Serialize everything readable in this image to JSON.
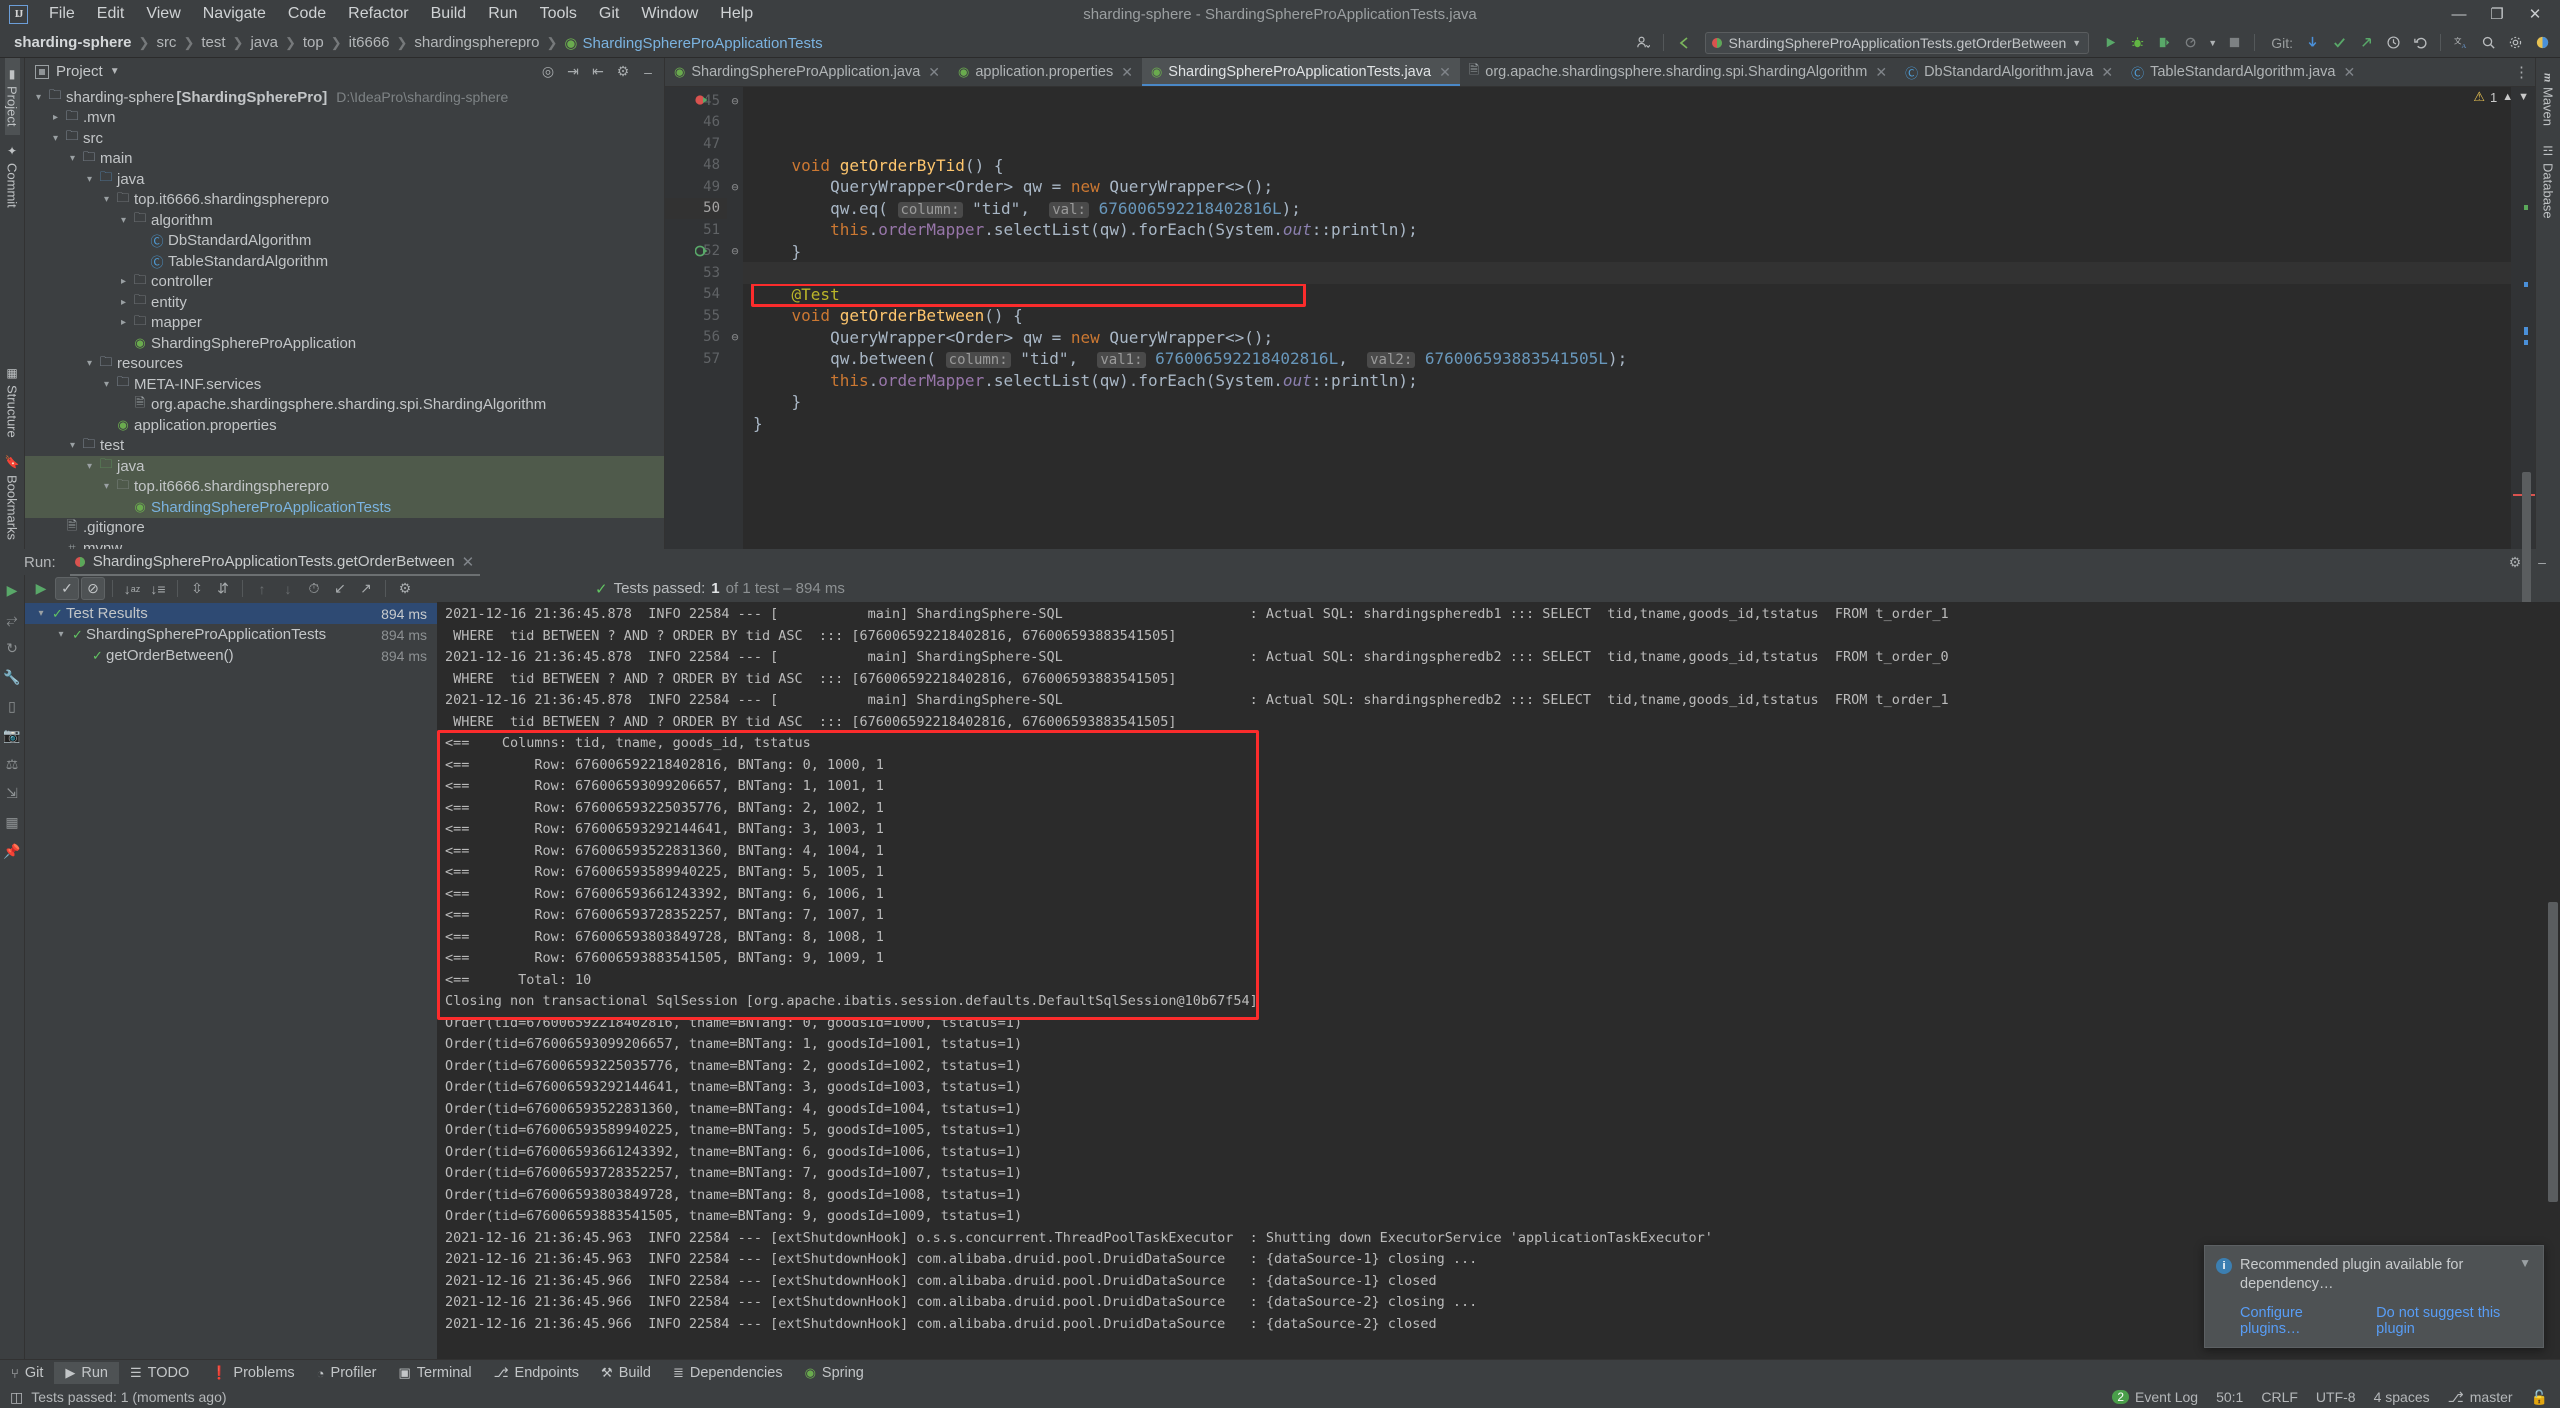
{
  "window": {
    "title": "sharding-sphere - ShardingSphereProApplicationTests.java",
    "logo": "IJ",
    "minimize": "—",
    "maximize": "❐",
    "close": "✕"
  },
  "menu": [
    "File",
    "Edit",
    "View",
    "Navigate",
    "Code",
    "Refactor",
    "Build",
    "Run",
    "Tools",
    "Git",
    "Window",
    "Help"
  ],
  "navbar": {
    "breadcrumbs": [
      "sharding-sphere",
      "src",
      "test",
      "java",
      "top",
      "it6666",
      "shardingspherepro",
      "ShardingSphereProApplicationTests"
    ],
    "run_config": "ShardingSphereProApplicationTests.getOrderBetween",
    "git_label": "Git:",
    "icons": {
      "user": "user-icon",
      "back": "back-arrow-icon",
      "run": "run-icon",
      "debug": "debug-icon",
      "coverage": "coverage-icon",
      "profile": "profile-icon",
      "stop": "stop-icon",
      "update": "git-update-icon",
      "commit": "git-commit-icon",
      "push": "git-push-icon",
      "history": "history-icon",
      "rollback": "rollback-icon",
      "translate": "translate-icon",
      "search": "search-icon",
      "settings": "settings-icon",
      "layout": "layout-icon"
    }
  },
  "left_strip": {
    "tabs": [
      {
        "label": "Project",
        "icon": "project-icon",
        "selected": true
      },
      {
        "label": "Commit",
        "icon": "commit-icon",
        "selected": false
      }
    ],
    "bottom_tabs": [
      {
        "label": "Structure",
        "icon": "structure-icon"
      },
      {
        "label": "Bookmarks",
        "icon": "bookmark-icon"
      }
    ]
  },
  "right_strip": {
    "tabs": [
      {
        "label": "Maven",
        "icon": "maven-icon"
      },
      {
        "label": "Database",
        "icon": "database-icon"
      }
    ]
  },
  "project_panel": {
    "title": "Project",
    "tools": [
      "target-icon",
      "collapse-all-icon",
      "expand-icon",
      "gear-icon",
      "minimize-icon"
    ],
    "tree": [
      {
        "indent": 0,
        "arrow": "⌄",
        "icon": "module-folder",
        "icon_class": "icoFolder",
        "label": "sharding-sphere",
        "bold_label": "[ShardingSpherePro]",
        "hint": "D:\\IdeaPro\\sharding-sphere",
        "selected": false
      },
      {
        "indent": 1,
        "arrow": "›",
        "icon": "folder",
        "icon_class": "icoFolder",
        "label": ".mvn",
        "selected": false
      },
      {
        "indent": 1,
        "arrow": "⌄",
        "icon": "folder",
        "icon_class": "icoFolder",
        "label": "src",
        "selected": false
      },
      {
        "indent": 2,
        "arrow": "⌄",
        "icon": "folder",
        "icon_class": "icoFolder",
        "label": "main",
        "selected": false
      },
      {
        "indent": 3,
        "arrow": "⌄",
        "icon": "source-folder",
        "icon_class": "icoFolderBlue",
        "label": "java",
        "selected": false
      },
      {
        "indent": 4,
        "arrow": "⌄",
        "icon": "package",
        "icon_class": "icoPkg",
        "label": "top.it6666.shardingspherepro",
        "selected": false
      },
      {
        "indent": 5,
        "arrow": "⌄",
        "icon": "package",
        "icon_class": "icoPkg",
        "label": "algorithm",
        "selected": false
      },
      {
        "indent": 6,
        "arrow": "",
        "icon": "class",
        "icon_class": "icoClass",
        "label": "DbStandardAlgorithm",
        "selected": false
      },
      {
        "indent": 6,
        "arrow": "",
        "icon": "class",
        "icon_class": "icoClass",
        "label": "TableStandardAlgorithm",
        "selected": false
      },
      {
        "indent": 5,
        "arrow": "›",
        "icon": "package",
        "icon_class": "icoPkg",
        "label": "controller",
        "selected": false
      },
      {
        "indent": 5,
        "arrow": "›",
        "icon": "package",
        "icon_class": "icoPkg",
        "label": "entity",
        "selected": false
      },
      {
        "indent": 5,
        "arrow": "›",
        "icon": "package",
        "icon_class": "icoPkg",
        "label": "mapper",
        "selected": false
      },
      {
        "indent": 5,
        "arrow": "",
        "icon": "spring-class",
        "icon_class": "icoSpring",
        "label": "ShardingSphereProApplication",
        "selected": false
      },
      {
        "indent": 3,
        "arrow": "⌄",
        "icon": "resource-folder",
        "icon_class": "icoFolder",
        "label": "resources",
        "selected": false
      },
      {
        "indent": 4,
        "arrow": "⌄",
        "icon": "folder",
        "icon_class": "icoFolder",
        "label": "META-INF.services",
        "selected": false
      },
      {
        "indent": 5,
        "arrow": "",
        "icon": "file",
        "icon_class": "icoFile",
        "label": "org.apache.shardingsphere.sharding.spi.ShardingAlgorithm",
        "selected": false
      },
      {
        "indent": 4,
        "arrow": "",
        "icon": "properties",
        "icon_class": "icoSpring",
        "label": "application.properties",
        "selected": false
      },
      {
        "indent": 2,
        "arrow": "⌄",
        "icon": "folder",
        "icon_class": "icoFolder",
        "label": "test",
        "selected": false
      },
      {
        "indent": 3,
        "arrow": "⌄",
        "icon": "test-source-folder",
        "icon_class": "icoFolderGreen",
        "label": "java",
        "selected": true
      },
      {
        "indent": 4,
        "arrow": "⌄",
        "icon": "package",
        "icon_class": "icoPkg",
        "label": "top.it6666.shardingspherepro",
        "selected": true
      },
      {
        "indent": 5,
        "arrow": "",
        "icon": "spring-test-class",
        "icon_class": "icoSpring",
        "label": "ShardingSphereProApplicationTests",
        "selected": true,
        "blue": true
      },
      {
        "indent": 1,
        "arrow": "",
        "icon": "gitignore-file",
        "icon_class": "icoFile",
        "label": ".gitignore",
        "selected": false
      },
      {
        "indent": 1,
        "arrow": "",
        "icon": "script-file",
        "icon_class": "icoFile",
        "label": "mvnw",
        "selected": false
      }
    ]
  },
  "editor": {
    "tabs": [
      {
        "label": "ShardingSphereProApplication.java",
        "icon": "spring-class-icon",
        "active": false
      },
      {
        "label": "application.properties",
        "icon": "properties-icon",
        "active": false
      },
      {
        "label": "ShardingSphereProApplicationTests.java",
        "icon": "spring-test-class-icon",
        "active": true
      },
      {
        "label": "org.apache.shardingsphere.sharding.spi.ShardingAlgorithm",
        "icon": "file-icon",
        "active": false
      },
      {
        "label": "DbStandardAlgorithm.java",
        "icon": "class-icon",
        "active": false
      },
      {
        "label": "TableStandardAlgorithm.java",
        "icon": "class-icon",
        "active": false
      }
    ],
    "first_line_number": 45,
    "line_numbers": [
      45,
      46,
      47,
      48,
      49,
      50,
      51,
      52,
      53,
      54,
      55,
      56,
      57
    ],
    "current_line": 50,
    "warning_count": "1",
    "code_lines": [
      "    void getOrderByTid() {",
      "        QueryWrapper<Order> qw = new QueryWrapper<>();",
      "        qw.eq( column: \"tid\",  val: 676006592218402816L);",
      "        this.orderMapper.selectList(qw).forEach(System.out::println);",
      "    }",
      "",
      "    @Test",
      "    void getOrderBetween() {",
      "        QueryWrapper<Order> qw = new QueryWrapper<>();",
      "        qw.between( column: \"tid\",  val1: 676006592218402816L,  val2: 676006593883541505L);",
      "        this.orderMapper.selectList(qw).forEach(System.out::println);",
      "    }",
      "}"
    ],
    "highlighted_line_index": 9
  },
  "run_panel": {
    "label": "Run:",
    "tab_title": "ShardingSphereProApplicationTests.getOrderBetween",
    "toolbar_icons": [
      "rerun-icon",
      "show-passed-icon",
      "show-ignored-icon",
      "sort-alpha-icon",
      "sort-duration-icon",
      "expand-all-icon",
      "collapse-all-icon",
      "prev-failed-icon",
      "next-failed-icon",
      "history-icon",
      "import-icon",
      "export-icon",
      "settings-icon"
    ],
    "side_icons": [
      "run-icon",
      "rerun-failed-icon",
      "restart-icon",
      "wrench-icon",
      "console-icon",
      "screenshot-icon",
      "suppress-icon",
      "export-icon",
      "layout-icon",
      "pin-icon"
    ],
    "status": {
      "prefix": "Tests passed:",
      "count": "1",
      "suffix": "of 1 test – 894 ms"
    },
    "test_tree": [
      {
        "indent": 0,
        "label": "Test Results",
        "time": "894 ms",
        "selected": true,
        "arrow": "⌄"
      },
      {
        "indent": 1,
        "label": "ShardingSphereProApplicationTests",
        "time": "894 ms",
        "selected": false,
        "arrow": "⌄"
      },
      {
        "indent": 2,
        "label": "getOrderBetween()",
        "time": "894 ms",
        "selected": false,
        "arrow": ""
      }
    ],
    "console_lines": [
      "2021-12-16 21:36:45.878  INFO 22584 --- [           main] ShardingSphere-SQL                       : Actual SQL: shardingspheredb1 ::: SELECT  tid,tname,goods_id,tstatus  FROM t_order_1",
      " WHERE  tid BETWEEN ? AND ? ORDER BY tid ASC  ::: [676006592218402816, 676006593883541505]",
      "2021-12-16 21:36:45.878  INFO 22584 --- [           main] ShardingSphere-SQL                       : Actual SQL: shardingspheredb2 ::: SELECT  tid,tname,goods_id,tstatus  FROM t_order_0",
      " WHERE  tid BETWEEN ? AND ? ORDER BY tid ASC  ::: [676006592218402816, 676006593883541505]",
      "2021-12-16 21:36:45.878  INFO 22584 --- [           main] ShardingSphere-SQL                       : Actual SQL: shardingspheredb2 ::: SELECT  tid,tname,goods_id,tstatus  FROM t_order_1",
      " WHERE  tid BETWEEN ? AND ? ORDER BY tid ASC  ::: [676006592218402816, 676006593883541505]",
      "<==    Columns: tid, tname, goods_id, tstatus",
      "<==        Row: 676006592218402816, BNTang: 0, 1000, 1",
      "<==        Row: 676006593099206657, BNTang: 1, 1001, 1",
      "<==        Row: 676006593225035776, BNTang: 2, 1002, 1",
      "<==        Row: 676006593292144641, BNTang: 3, 1003, 1",
      "<==        Row: 676006593522831360, BNTang: 4, 1004, 1",
      "<==        Row: 676006593589940225, BNTang: 5, 1005, 1",
      "<==        Row: 676006593661243392, BNTang: 6, 1006, 1",
      "<==        Row: 676006593728352257, BNTang: 7, 1007, 1",
      "<==        Row: 676006593803849728, BNTang: 8, 1008, 1",
      "<==        Row: 676006593883541505, BNTang: 9, 1009, 1",
      "<==      Total: 10",
      "Closing non transactional SqlSession [org.apache.ibatis.session.defaults.DefaultSqlSession@10b67f54]",
      "Order(tid=676006592218402816, tname=BNTang: 0, goodsId=1000, tstatus=1)",
      "Order(tid=676006593099206657, tname=BNTang: 1, goodsId=1001, tstatus=1)",
      "Order(tid=676006593225035776, tname=BNTang: 2, goodsId=1002, tstatus=1)",
      "Order(tid=676006593292144641, tname=BNTang: 3, goodsId=1003, tstatus=1)",
      "Order(tid=676006593522831360, tname=BNTang: 4, goodsId=1004, tstatus=1)",
      "Order(tid=676006593589940225, tname=BNTang: 5, goodsId=1005, tstatus=1)",
      "Order(tid=676006593661243392, tname=BNTang: 6, goodsId=1006, tstatus=1)",
      "Order(tid=676006593728352257, tname=BNTang: 7, goodsId=1007, tstatus=1)",
      "Order(tid=676006593803849728, tname=BNTang: 8, goodsId=1008, tstatus=1)",
      "Order(tid=676006593883541505, tname=BNTang: 9, goodsId=1009, tstatus=1)",
      "2021-12-16 21:36:45.963  INFO 22584 --- [extShutdownHook] o.s.s.concurrent.ThreadPoolTaskExecutor  : Shutting down ExecutorService 'applicationTaskExecutor'",
      "2021-12-16 21:36:45.963  INFO 22584 --- [extShutdownHook] com.alibaba.druid.pool.DruidDataSource   : {dataSource-1} closing ...",
      "2021-12-16 21:36:45.966  INFO 22584 --- [extShutdownHook] com.alibaba.druid.pool.DruidDataSource   : {dataSource-1} closed",
      "2021-12-16 21:36:45.966  INFO 22584 --- [extShutdownHook] com.alibaba.druid.pool.DruidDataSource   : {dataSource-2} closing ...",
      "2021-12-16 21:36:45.966  INFO 22584 --- [extShutdownHook] com.alibaba.druid.pool.DruidDataSource   : {dataSource-2} closed"
    ],
    "highlight_start_index": 6,
    "highlight_end_index": 18
  },
  "bottom_tools": [
    {
      "label": "Git",
      "icon": "git-icon",
      "selected": false
    },
    {
      "label": "Run",
      "icon": "run-icon",
      "selected": true
    },
    {
      "label": "TODO",
      "icon": "todo-icon",
      "selected": false
    },
    {
      "label": "Problems",
      "icon": "problems-icon",
      "selected": false
    },
    {
      "label": "Profiler",
      "icon": "profiler-icon",
      "selected": false
    },
    {
      "label": "Terminal",
      "icon": "terminal-icon",
      "selected": false
    },
    {
      "label": "Endpoints",
      "icon": "endpoints-icon",
      "selected": false
    },
    {
      "label": "Build",
      "icon": "build-icon",
      "selected": false
    },
    {
      "label": "Dependencies",
      "icon": "dependencies-icon",
      "selected": false
    },
    {
      "label": "Spring",
      "icon": "spring-icon",
      "selected": false
    }
  ],
  "status_bar": {
    "message": "Tests passed: 1 (moments ago)",
    "event_log": "Event Log",
    "event_badge": "2",
    "caret": "50:1",
    "line_sep": "CRLF",
    "encoding": "UTF-8",
    "indent": "4 spaces",
    "branch": "master",
    "lock_icon": "lock-icon"
  },
  "notification": {
    "title": "Recommended plugin available for dependency…",
    "link_configure": "Configure plugins…",
    "link_dismiss": "Do not suggest this plugin"
  }
}
